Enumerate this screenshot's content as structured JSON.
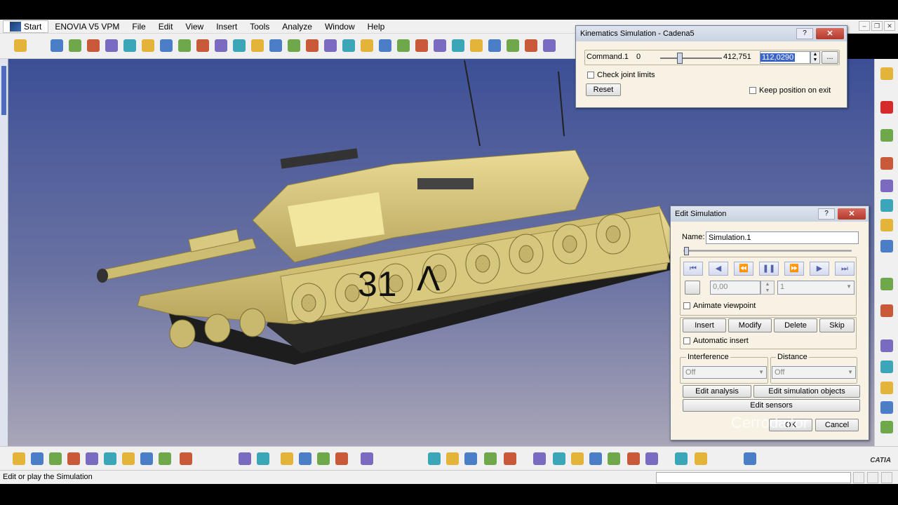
{
  "menu": {
    "start": "Start",
    "items": [
      "ENOVIA V5 VPM",
      "File",
      "Edit",
      "View",
      "Insert",
      "Tools",
      "Analyze",
      "Window",
      "Help"
    ]
  },
  "model": {
    "hull_number": "31",
    "hull_mark": "Λ"
  },
  "kinematics_dialog": {
    "title": "Kinematics Simulation - Cadena5",
    "command_label": "Command.1",
    "min_value": "0",
    "max_value": "412,751",
    "current_value": "112,0290",
    "slider_level": 0.27,
    "check_joint_limits": "Check joint limits",
    "reset_label": "Reset",
    "keep_position": "Keep position on exit",
    "more_label": "..."
  },
  "edit_dialog": {
    "title": "Edit Simulation",
    "name_label": "Name:",
    "name_value": "Simulation.1",
    "step_value": "0,00",
    "step_select": "1",
    "animate_viewpoint": "Animate viewpoint",
    "insert": "Insert",
    "modify": "Modify",
    "delete": "Delete",
    "skip": "Skip",
    "automatic_insert": "Automatic insert",
    "interference_label": "Interference",
    "interference_value": "Off",
    "distance_label": "Distance",
    "distance_value": "Off",
    "edit_analysis": "Edit analysis",
    "edit_simulation_objects": "Edit simulation objects",
    "edit_sensors": "Edit sensors",
    "ok": "OK",
    "cancel": "Cancel",
    "watermark": "Cerrodaitor"
  },
  "status": {
    "text": "Edit or play the Simulation"
  },
  "logo": {
    "text": "CATIA"
  },
  "colors": {
    "viewport_top": "#3c4f96",
    "tank": "#d6c77e",
    "dialog_bg": "#f7f2e4"
  }
}
